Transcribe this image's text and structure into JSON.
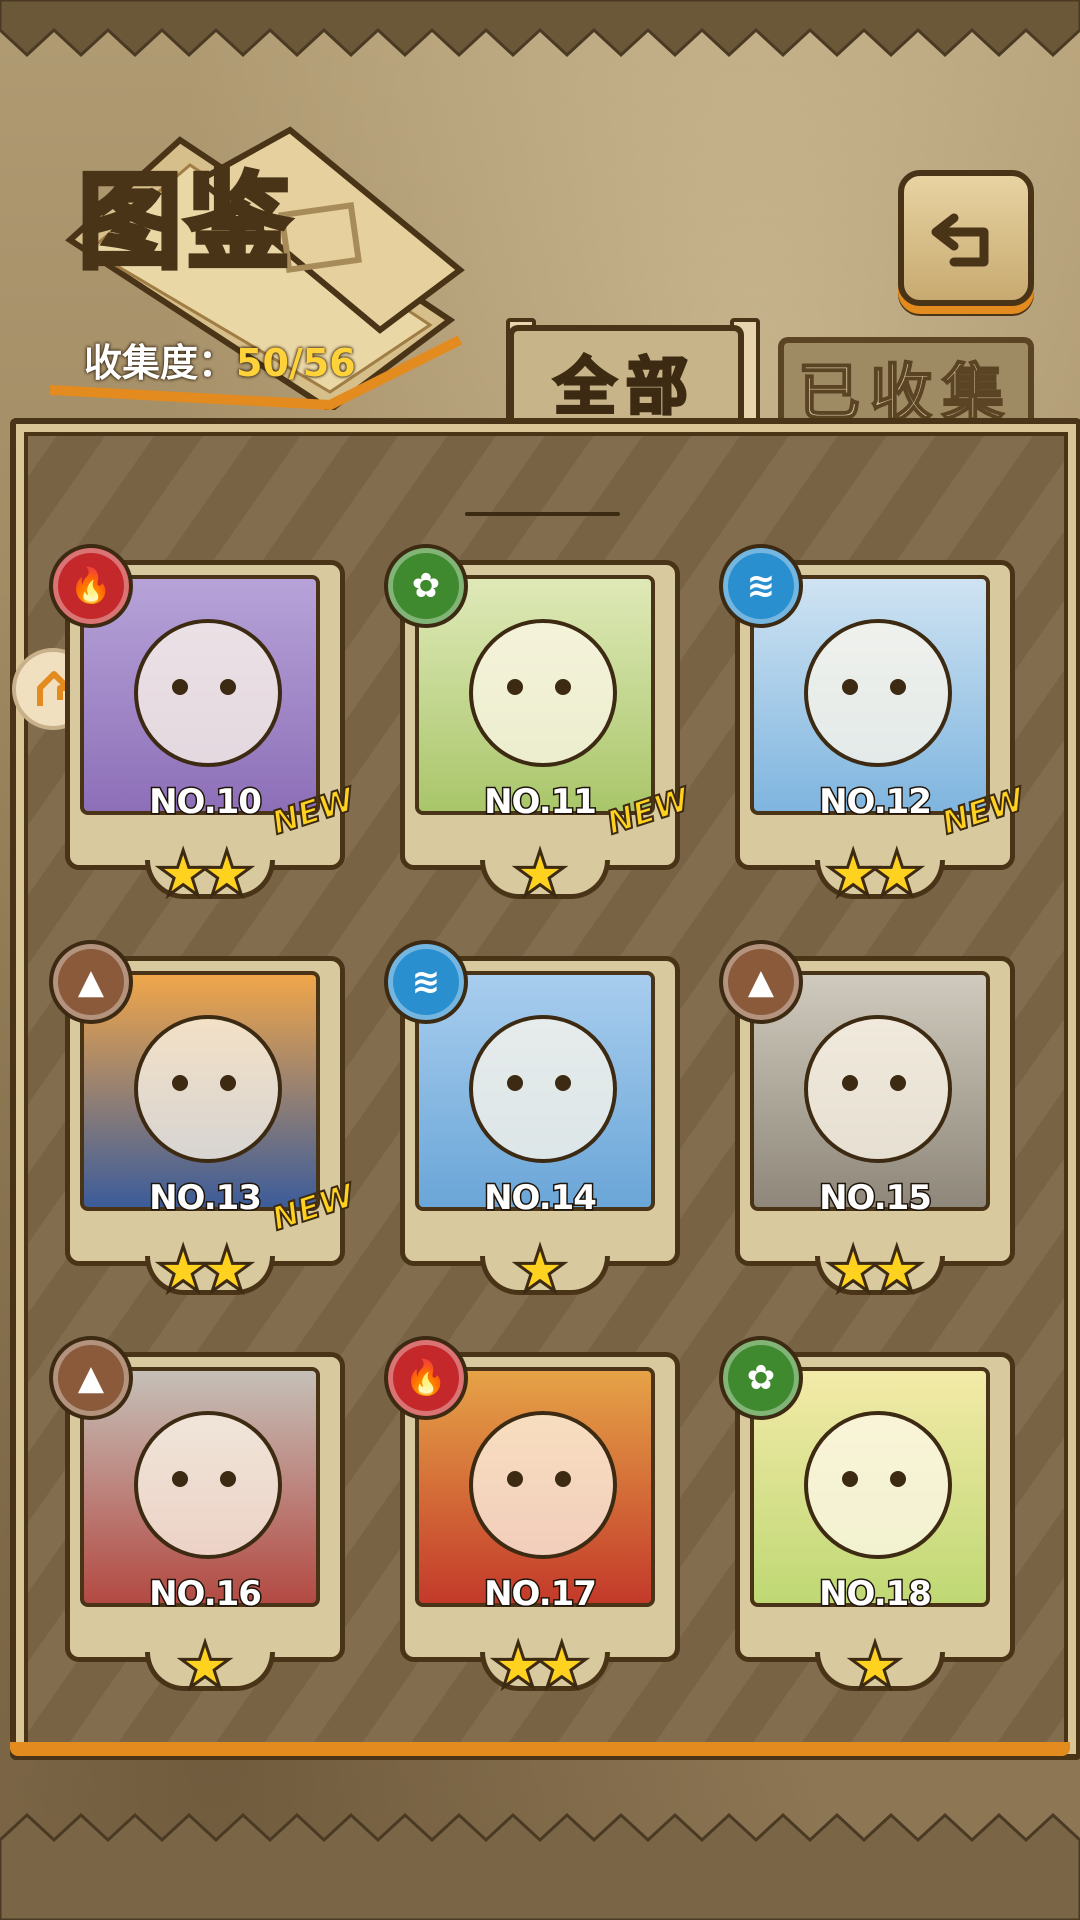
{
  "header": {
    "title": "图鉴",
    "collection_label": "收集度：",
    "collection_value": "50/56"
  },
  "tabs": [
    {
      "label": "全部",
      "active": true
    },
    {
      "label": "已收集",
      "active": false
    }
  ],
  "cards": [
    {
      "no": "NO.10",
      "stars": 2,
      "element": "fire",
      "new": true
    },
    {
      "no": "NO.11",
      "stars": 1,
      "element": "leaf",
      "new": true
    },
    {
      "no": "NO.12",
      "stars": 2,
      "element": "water",
      "new": true
    },
    {
      "no": "NO.13",
      "stars": 2,
      "element": "earth",
      "new": true
    },
    {
      "no": "NO.14",
      "stars": 1,
      "element": "water",
      "new": false
    },
    {
      "no": "NO.15",
      "stars": 2,
      "element": "earth",
      "new": false
    },
    {
      "no": "NO.16",
      "stars": 1,
      "element": "earth",
      "new": false
    },
    {
      "no": "NO.17",
      "stars": 2,
      "element": "fire",
      "new": false
    },
    {
      "no": "NO.18",
      "stars": 1,
      "element": "leaf",
      "new": false
    }
  ],
  "new_label": "NEW",
  "element_colors": {
    "fire": "#c5282a",
    "leaf": "#3f8a2e",
    "water": "#2a8fcf",
    "earth": "#8a5a3a"
  },
  "icons": {
    "back": "return-arrow-icon",
    "side": "turn-arrow-icon"
  }
}
